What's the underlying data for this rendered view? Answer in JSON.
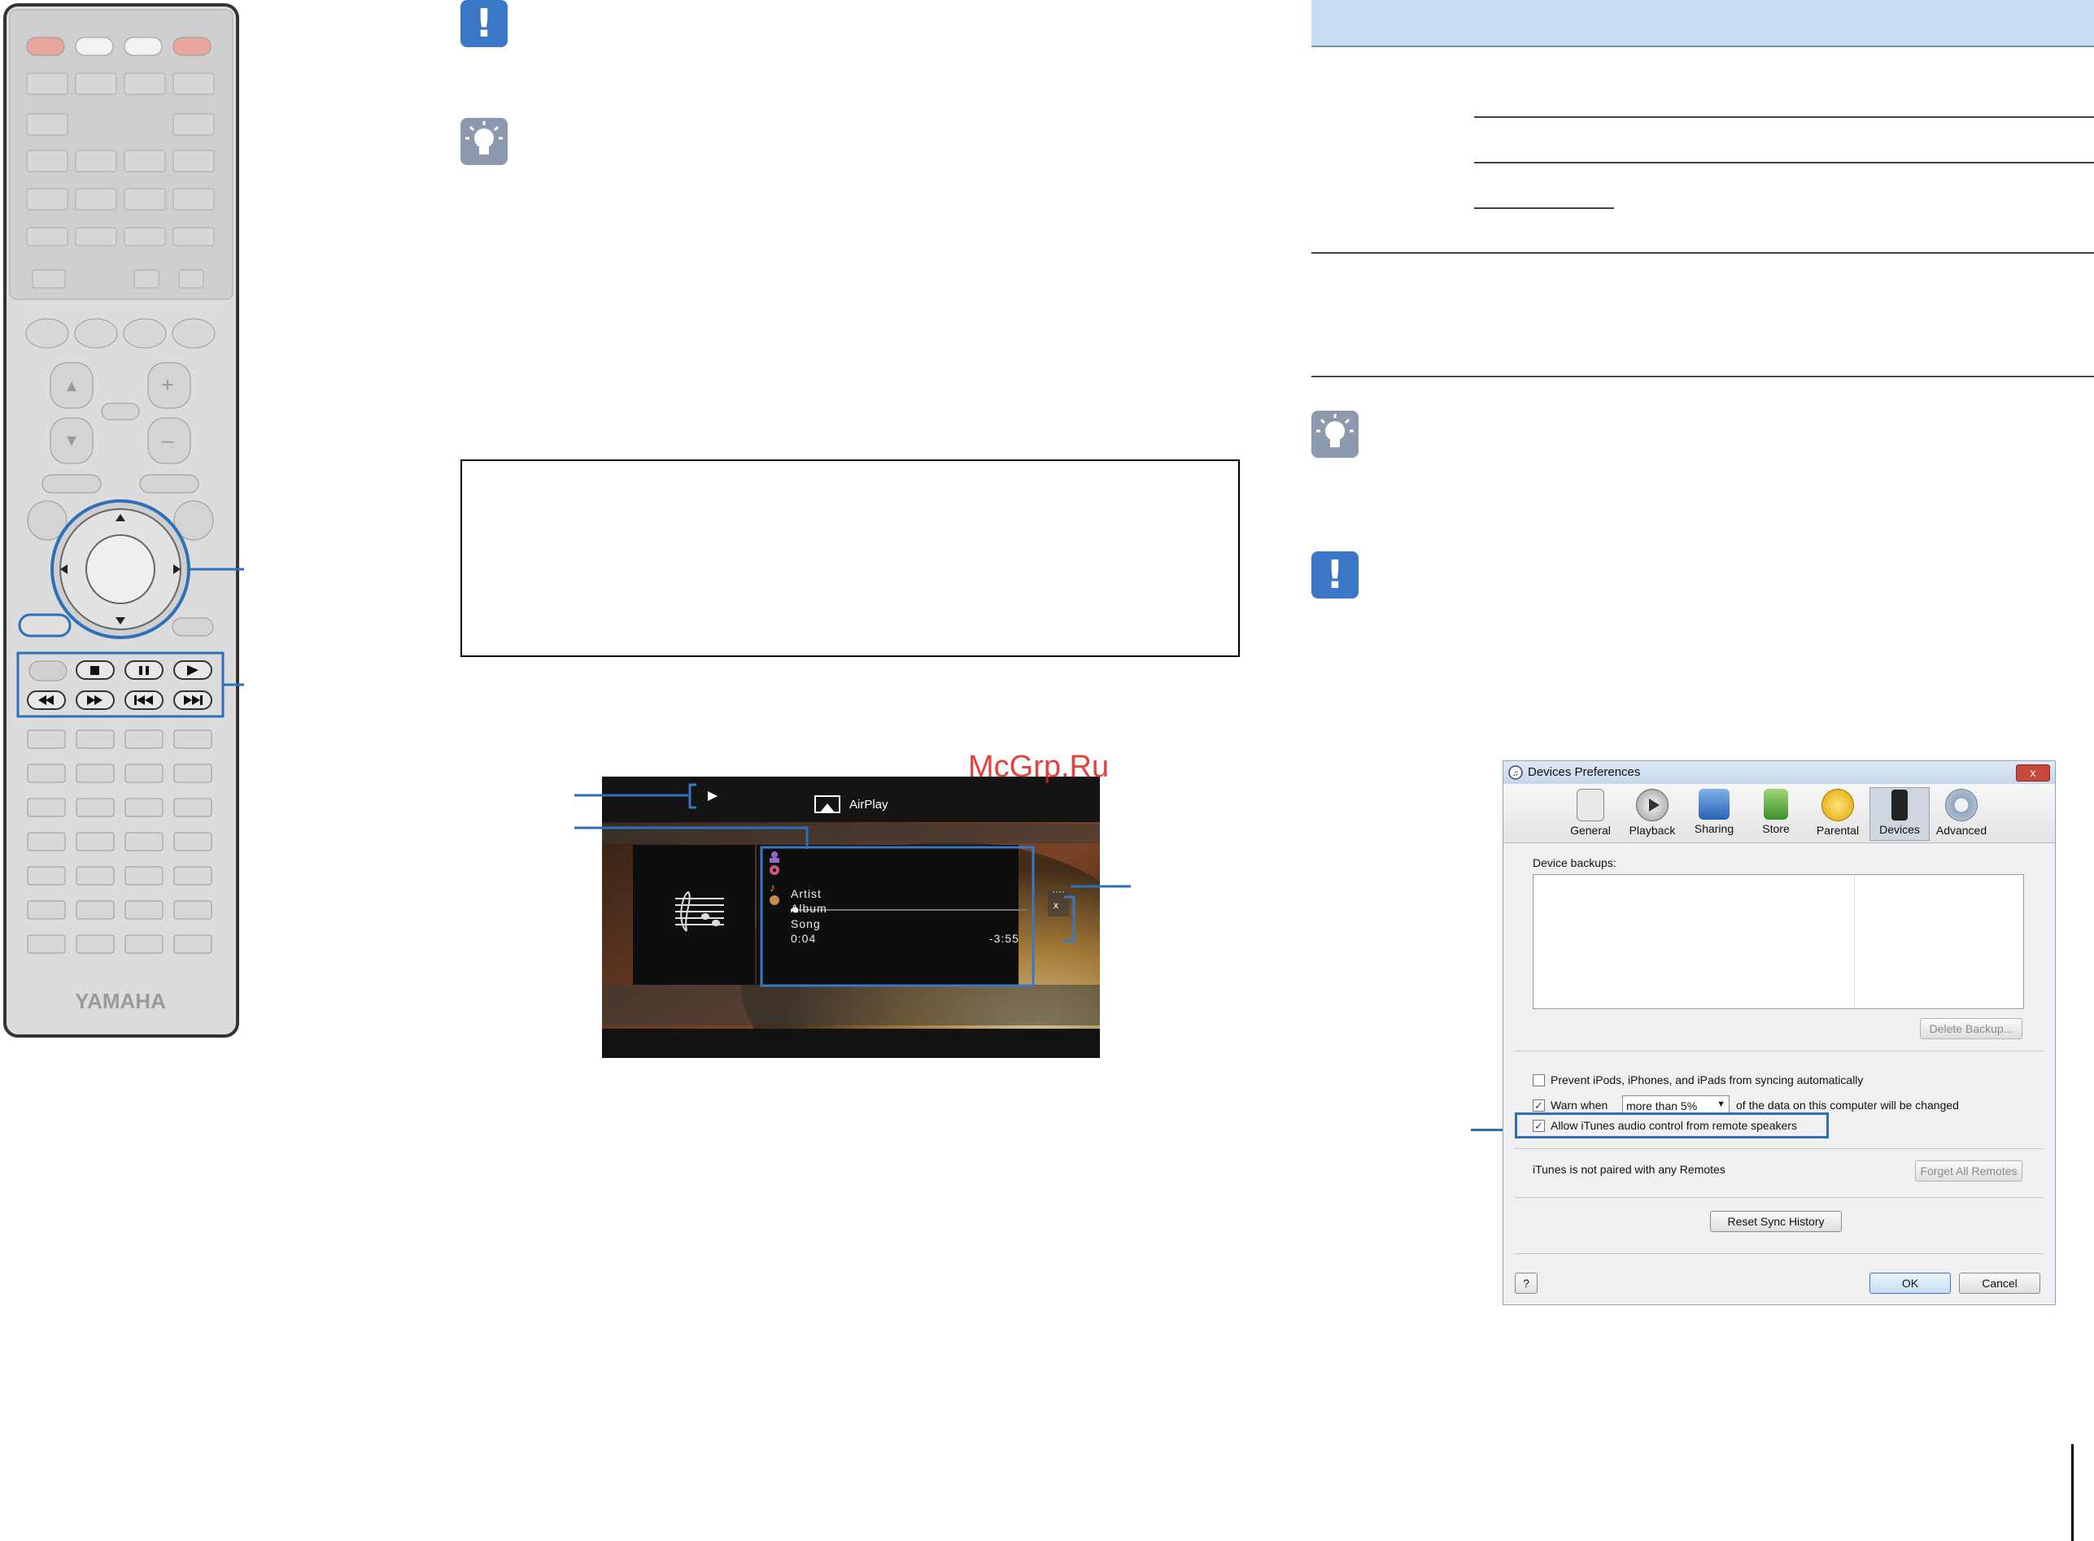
{
  "remote": {
    "brand": "YAMAHA",
    "icons": [
      "power-icon",
      "cursor-up-icon",
      "cursor-down-icon",
      "cursor-left-icon",
      "cursor-right-icon",
      "stop-icon",
      "pause-icon",
      "play-icon",
      "rewind-icon",
      "fast-forward-icon",
      "skip-back-icon",
      "skip-forward-icon"
    ]
  },
  "note_icons": {
    "warning": "!",
    "tip": "tip-bulb-icon"
  },
  "watermark": "McGrp.Ru",
  "airplay_screen": {
    "source_label": "AirPlay",
    "artist": "Artist",
    "album": "Album",
    "song": "Song",
    "elapsed": "0:04",
    "remaining": "-3:55",
    "progress_fraction": 0.02
  },
  "itunes": {
    "window_title": "Devices Preferences",
    "close_label": "x",
    "toolbar": [
      {
        "label": "General",
        "icon": "general-icon"
      },
      {
        "label": "Playback",
        "icon": "playback-icon"
      },
      {
        "label": "Sharing",
        "icon": "sharing-icon"
      },
      {
        "label": "Store",
        "icon": "store-icon"
      },
      {
        "label": "Parental",
        "icon": "parental-icon"
      },
      {
        "label": "Devices",
        "icon": "devices-icon"
      },
      {
        "label": "Advanced",
        "icon": "advanced-icon"
      }
    ],
    "active_tab": "Devices",
    "device_backups_label": "Device backups:",
    "delete_backup_label": "Delete Backup...",
    "prevent_sync_label": "Prevent iPods, iPhones, and iPads from syncing automatically",
    "prevent_sync_checked": false,
    "warn_when_label": "Warn when",
    "warn_threshold": "more than 5%",
    "warn_suffix": "of the data on this computer will be changed",
    "warn_checked": true,
    "allow_remote_label": "Allow iTunes audio control from remote speakers",
    "allow_remote_checked": true,
    "remotes_status": "iTunes is not paired with any Remotes",
    "forget_remotes_label": "Forget All Remotes",
    "reset_sync_label": "Reset Sync History",
    "help_label": "?",
    "ok_label": "OK",
    "cancel_label": "Cancel",
    "colors": {
      "accent": "#3a78c6",
      "highlight": "#2d6fb8"
    }
  }
}
